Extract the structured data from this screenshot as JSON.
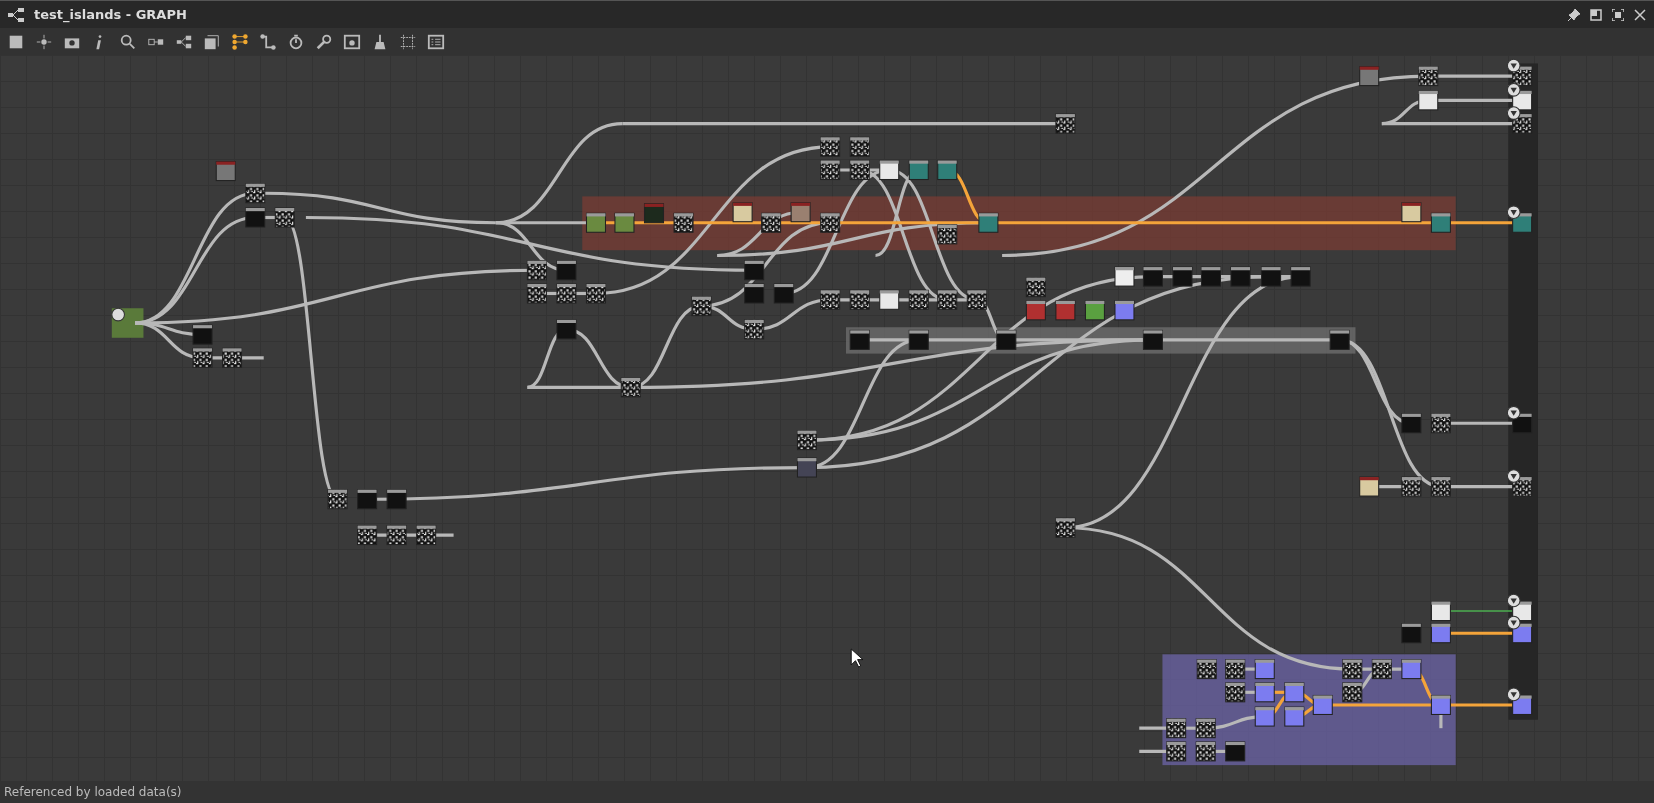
{
  "window": {
    "title": "test_islands - GRAPH"
  },
  "toolbar": {
    "buttons": [
      {
        "selected": false
      },
      {
        "selected": false
      },
      {
        "selected": false
      },
      {
        "selected": false
      },
      {
        "selected": false
      },
      {
        "selected": false
      },
      {
        "selected": false
      },
      {
        "selected": false
      },
      {
        "selected": true
      },
      {
        "selected": false
      },
      {
        "selected": false
      },
      {
        "selected": false
      },
      {
        "selected": false
      },
      {
        "selected": false
      },
      {
        "selected": false
      },
      {
        "selected": false
      }
    ]
  },
  "frames": [
    {
      "color": "#7a3c34"
    },
    {
      "color": "#707070"
    },
    {
      "color": "#6c64a8"
    }
  ],
  "status_bar": {
    "text": "Referenced by loaded data(s)"
  }
}
